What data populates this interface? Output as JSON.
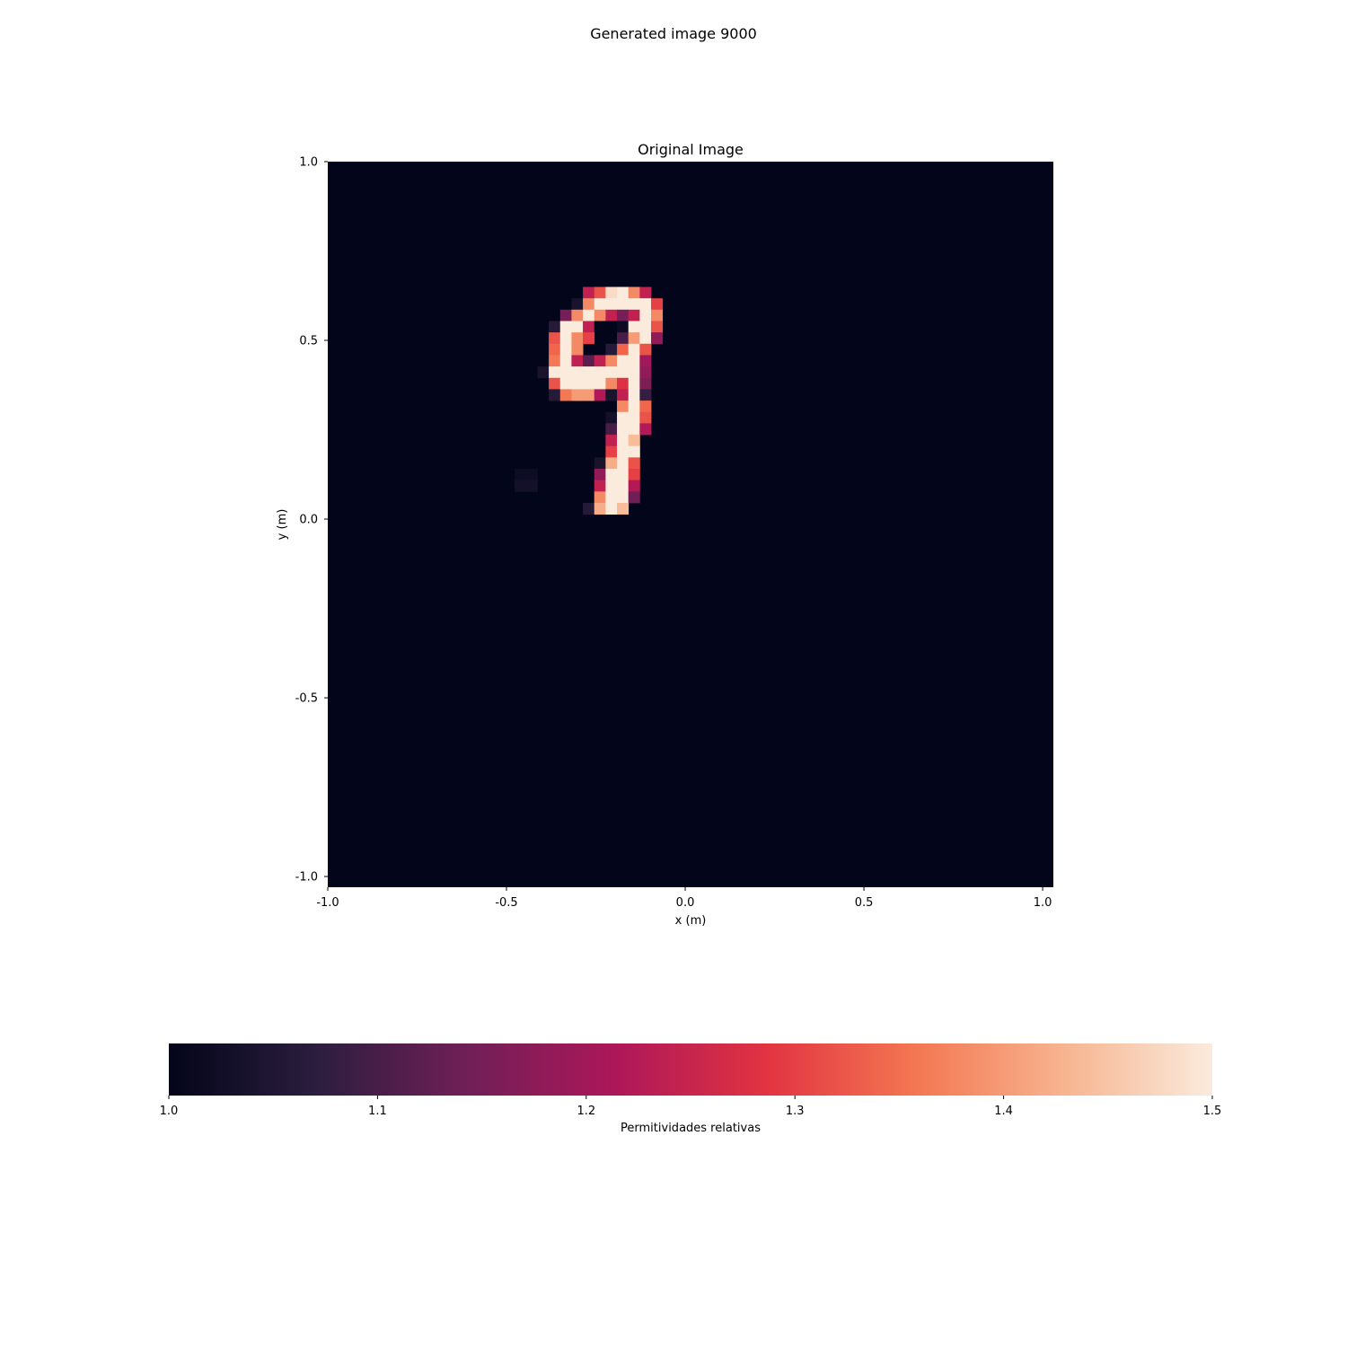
{
  "figure": {
    "suptitle": "Generated image 9000"
  },
  "chart_data": {
    "type": "heatmap",
    "title": "Original Image",
    "xlabel": "x (m)",
    "ylabel": "y (m)",
    "xlim": [
      -1.0,
      1.03
    ],
    "ylim": [
      -1.03,
      1.0
    ],
    "xticks": [
      -1.0,
      -0.5,
      0.0,
      0.5,
      1.0
    ],
    "xtick_labels": [
      "-1.0",
      "-0.5",
      "0.0",
      "0.5",
      "1.0"
    ],
    "yticks": [
      1.0,
      0.5,
      0.0,
      -0.5,
      -1.0
    ],
    "ytick_labels": [
      "1.0",
      "0.5",
      "0.0",
      "-0.5",
      "-1.0"
    ],
    "grid": false,
    "background_value": 1.0,
    "cell_size_m": 0.0318,
    "grid_origin": [
      -0.4135,
      0.6495
    ],
    "cells": [
      {
        "row": 0,
        "col": 4,
        "v": 1.24
      },
      {
        "row": 0,
        "col": 5,
        "v": 1.32
      },
      {
        "row": 0,
        "col": 6,
        "v": 1.48
      },
      {
        "row": 0,
        "col": 7,
        "v": 1.5
      },
      {
        "row": 0,
        "col": 8,
        "v": 1.38
      },
      {
        "row": 0,
        "col": 9,
        "v": 1.24
      },
      {
        "row": 1,
        "col": 3,
        "v": 1.04
      },
      {
        "row": 1,
        "col": 4,
        "v": 1.38
      },
      {
        "row": 1,
        "col": 5,
        "v": 1.5
      },
      {
        "row": 1,
        "col": 6,
        "v": 1.5
      },
      {
        "row": 1,
        "col": 7,
        "v": 1.5
      },
      {
        "row": 1,
        "col": 8,
        "v": 1.5
      },
      {
        "row": 1,
        "col": 9,
        "v": 1.5
      },
      {
        "row": 1,
        "col": 10,
        "v": 1.3
      },
      {
        "row": 2,
        "col": 2,
        "v": 1.15
      },
      {
        "row": 2,
        "col": 3,
        "v": 1.38
      },
      {
        "row": 2,
        "col": 4,
        "v": 1.5
      },
      {
        "row": 2,
        "col": 5,
        "v": 1.38
      },
      {
        "row": 2,
        "col": 6,
        "v": 1.24
      },
      {
        "row": 2,
        "col": 7,
        "v": 1.15
      },
      {
        "row": 2,
        "col": 8,
        "v": 1.24
      },
      {
        "row": 2,
        "col": 9,
        "v": 1.5
      },
      {
        "row": 2,
        "col": 10,
        "v": 1.38
      },
      {
        "row": 3,
        "col": 1,
        "v": 1.06
      },
      {
        "row": 3,
        "col": 2,
        "v": 1.5
      },
      {
        "row": 3,
        "col": 3,
        "v": 1.5
      },
      {
        "row": 3,
        "col": 4,
        "v": 1.24
      },
      {
        "row": 3,
        "col": 5,
        "v": 1.0
      },
      {
        "row": 3,
        "col": 6,
        "v": 1.0
      },
      {
        "row": 3,
        "col": 7,
        "v": 1.02
      },
      {
        "row": 3,
        "col": 8,
        "v": 1.5
      },
      {
        "row": 3,
        "col": 9,
        "v": 1.5
      },
      {
        "row": 3,
        "col": 10,
        "v": 1.32
      },
      {
        "row": 4,
        "col": 1,
        "v": 1.32
      },
      {
        "row": 4,
        "col": 2,
        "v": 1.5
      },
      {
        "row": 4,
        "col": 3,
        "v": 1.38
      },
      {
        "row": 4,
        "col": 4,
        "v": 1.3
      },
      {
        "row": 4,
        "col": 6,
        "v": 1.0
      },
      {
        "row": 4,
        "col": 7,
        "v": 1.1
      },
      {
        "row": 4,
        "col": 8,
        "v": 1.4
      },
      {
        "row": 4,
        "col": 9,
        "v": 1.5
      },
      {
        "row": 4,
        "col": 10,
        "v": 1.18
      },
      {
        "row": 5,
        "col": 1,
        "v": 1.34
      },
      {
        "row": 5,
        "col": 2,
        "v": 1.5
      },
      {
        "row": 5,
        "col": 3,
        "v": 1.38
      },
      {
        "row": 5,
        "col": 5,
        "v": 1.0
      },
      {
        "row": 5,
        "col": 6,
        "v": 1.06
      },
      {
        "row": 5,
        "col": 7,
        "v": 1.34
      },
      {
        "row": 5,
        "col": 8,
        "v": 1.5
      },
      {
        "row": 5,
        "col": 9,
        "v": 1.32
      },
      {
        "row": 6,
        "col": 1,
        "v": 1.36
      },
      {
        "row": 6,
        "col": 2,
        "v": 1.5
      },
      {
        "row": 6,
        "col": 3,
        "v": 1.24
      },
      {
        "row": 6,
        "col": 4,
        "v": 1.12
      },
      {
        "row": 6,
        "col": 5,
        "v": 1.24
      },
      {
        "row": 6,
        "col": 6,
        "v": 1.38
      },
      {
        "row": 6,
        "col": 7,
        "v": 1.5
      },
      {
        "row": 6,
        "col": 8,
        "v": 1.5
      },
      {
        "row": 6,
        "col": 9,
        "v": 1.2
      },
      {
        "row": 7,
        "col": 0,
        "v": 1.04
      },
      {
        "row": 7,
        "col": 1,
        "v": 1.5
      },
      {
        "row": 7,
        "col": 2,
        "v": 1.5
      },
      {
        "row": 7,
        "col": 3,
        "v": 1.5
      },
      {
        "row": 7,
        "col": 4,
        "v": 1.5
      },
      {
        "row": 7,
        "col": 5,
        "v": 1.5
      },
      {
        "row": 7,
        "col": 6,
        "v": 1.5
      },
      {
        "row": 7,
        "col": 7,
        "v": 1.5
      },
      {
        "row": 7,
        "col": 8,
        "v": 1.5
      },
      {
        "row": 7,
        "col": 9,
        "v": 1.18
      },
      {
        "row": 8,
        "col": 1,
        "v": 1.32
      },
      {
        "row": 8,
        "col": 2,
        "v": 1.5
      },
      {
        "row": 8,
        "col": 3,
        "v": 1.5
      },
      {
        "row": 8,
        "col": 4,
        "v": 1.5
      },
      {
        "row": 8,
        "col": 5,
        "v": 1.5
      },
      {
        "row": 8,
        "col": 6,
        "v": 1.38
      },
      {
        "row": 8,
        "col": 7,
        "v": 1.28
      },
      {
        "row": 8,
        "col": 8,
        "v": 1.5
      },
      {
        "row": 8,
        "col": 9,
        "v": 1.16
      },
      {
        "row": 9,
        "col": 1,
        "v": 1.06
      },
      {
        "row": 9,
        "col": 2,
        "v": 1.36
      },
      {
        "row": 9,
        "col": 3,
        "v": 1.4
      },
      {
        "row": 9,
        "col": 4,
        "v": 1.4
      },
      {
        "row": 9,
        "col": 5,
        "v": 1.22
      },
      {
        "row": 9,
        "col": 6,
        "v": 1.04
      },
      {
        "row": 9,
        "col": 7,
        "v": 1.24
      },
      {
        "row": 9,
        "col": 8,
        "v": 1.5
      },
      {
        "row": 9,
        "col": 9,
        "v": 1.08
      },
      {
        "row": 10,
        "col": 7,
        "v": 1.38
      },
      {
        "row": 10,
        "col": 8,
        "v": 1.5
      },
      {
        "row": 10,
        "col": 9,
        "v": 1.34
      },
      {
        "row": 11,
        "col": 6,
        "v": 1.03
      },
      {
        "row": 11,
        "col": 7,
        "v": 1.5
      },
      {
        "row": 11,
        "col": 8,
        "v": 1.5
      },
      {
        "row": 11,
        "col": 9,
        "v": 1.32
      },
      {
        "row": 12,
        "col": 6,
        "v": 1.1
      },
      {
        "row": 12,
        "col": 7,
        "v": 1.5
      },
      {
        "row": 12,
        "col": 8,
        "v": 1.5
      },
      {
        "row": 12,
        "col": 9,
        "v": 1.22
      },
      {
        "row": 13,
        "col": 6,
        "v": 1.24
      },
      {
        "row": 13,
        "col": 7,
        "v": 1.5
      },
      {
        "row": 13,
        "col": 8,
        "v": 1.44
      },
      {
        "row": 14,
        "col": 6,
        "v": 1.3
      },
      {
        "row": 14,
        "col": 7,
        "v": 1.5
      },
      {
        "row": 14,
        "col": 8,
        "v": 1.5
      },
      {
        "row": 15,
        "col": 5,
        "v": 1.04
      },
      {
        "row": 15,
        "col": 6,
        "v": 1.42
      },
      {
        "row": 15,
        "col": 7,
        "v": 1.5
      },
      {
        "row": 15,
        "col": 8,
        "v": 1.32
      },
      {
        "row": 16,
        "col": -2,
        "v": 1.02
      },
      {
        "row": 16,
        "col": -1,
        "v": 1.02
      },
      {
        "row": 16,
        "col": 5,
        "v": 1.18
      },
      {
        "row": 16,
        "col": 6,
        "v": 1.5
      },
      {
        "row": 16,
        "col": 7,
        "v": 1.5
      },
      {
        "row": 16,
        "col": 8,
        "v": 1.3
      },
      {
        "row": 17,
        "col": -2,
        "v": 1.03
      },
      {
        "row": 17,
        "col": -1,
        "v": 1.03
      },
      {
        "row": 17,
        "col": 5,
        "v": 1.24
      },
      {
        "row": 17,
        "col": 6,
        "v": 1.5
      },
      {
        "row": 17,
        "col": 7,
        "v": 1.5
      },
      {
        "row": 17,
        "col": 8,
        "v": 1.22
      },
      {
        "row": 18,
        "col": 5,
        "v": 1.38
      },
      {
        "row": 18,
        "col": 6,
        "v": 1.5
      },
      {
        "row": 18,
        "col": 7,
        "v": 1.5
      },
      {
        "row": 18,
        "col": 8,
        "v": 1.14
      },
      {
        "row": 19,
        "col": 4,
        "v": 1.06
      },
      {
        "row": 19,
        "col": 5,
        "v": 1.42
      },
      {
        "row": 19,
        "col": 6,
        "v": 1.5
      },
      {
        "row": 19,
        "col": 7,
        "v": 1.44
      }
    ],
    "colorbar": {
      "label": "Permitividades relativas",
      "range": [
        1.0,
        1.5
      ],
      "ticks": [
        1.0,
        1.1,
        1.2,
        1.3,
        1.4,
        1.5
      ],
      "tick_labels": [
        "1.0",
        "1.1",
        "1.2",
        "1.3",
        "1.4",
        "1.5"
      ],
      "orientation": "horizontal",
      "colormap_stops": [
        "#03051a",
        "#2c1e3e",
        "#701f57",
        "#ad1759",
        "#e13342",
        "#f37651",
        "#f6b48f",
        "#faebdd"
      ]
    }
  }
}
